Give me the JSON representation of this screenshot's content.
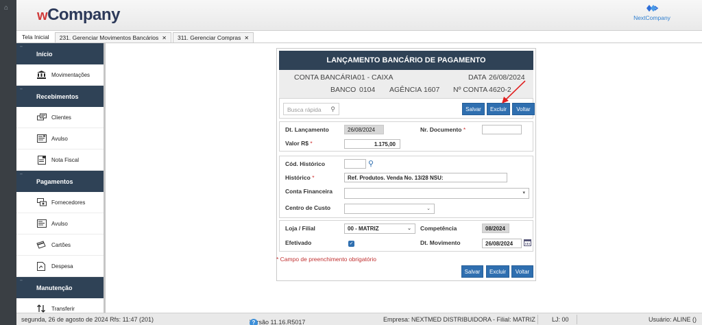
{
  "header": {
    "logo_w": "w",
    "logo_rest": "Company",
    "partner_logo": "NextCompany"
  },
  "tabs": [
    {
      "label": "Tela Inicial"
    },
    {
      "label": "231. Gerenciar Movimentos Bancários",
      "close": "✕"
    },
    {
      "label": "311. Gerenciar Compras",
      "close": "✕"
    }
  ],
  "sidebar": {
    "sections": [
      {
        "label": "Início"
      },
      {
        "label": "Recebimentos"
      },
      {
        "label": "Pagamentos"
      },
      {
        "label": "Manutenção"
      }
    ],
    "items": [
      {
        "label": "Movimentações",
        "icon": "bank-icon"
      },
      {
        "label": "Clientes",
        "icon": "clients-icon"
      },
      {
        "label": "Avulso",
        "icon": "receipt-icon"
      },
      {
        "label": "Nota Fiscal",
        "icon": "invoice-icon"
      },
      {
        "label": "Fornecedores",
        "icon": "suppliers-icon"
      },
      {
        "label": "Avulso",
        "icon": "receipt-icon"
      },
      {
        "label": "Cartões",
        "icon": "cards-icon"
      },
      {
        "label": "Despesa",
        "icon": "expense-icon"
      },
      {
        "label": "Transferir",
        "icon": "transfer-icon"
      }
    ]
  },
  "form": {
    "title": "LANÇAMENTO BANCÁRIO DE PAGAMENTO",
    "account": {
      "conta_label": "CONTA BANCÁRIA",
      "conta_value": "01 - CAIXA",
      "data_label": "DATA",
      "data_value": "26/08/2024",
      "banco_label": "BANCO",
      "banco_value": "0104",
      "agencia_label": "AGÊNCIA",
      "agencia_value": "1607",
      "nconta_label": "Nº CONTA",
      "nconta_value": "4620-2"
    },
    "search_placeholder": "Busca rápida",
    "buttons": {
      "save": "Salvar",
      "delete": "Excluir",
      "back": "Voltar"
    },
    "fields": {
      "dt_lancamento_label": "Dt. Lançamento",
      "dt_lancamento_value": "26/08/2024",
      "nr_documento_label": "Nr. Documento",
      "nr_documento_value": "",
      "valor_label": "Valor R$",
      "valor_value": "1.175,00",
      "cod_historico_label": "Cód. Histórico",
      "cod_historico_value": "",
      "historico_label": "Histórico",
      "historico_value": "Ref.  Produtos. Venda  No. 13/28 NSU:",
      "conta_financeira_label": "Conta Financeira",
      "conta_financeira_value": "",
      "centro_custo_label": "Centro de Custo",
      "centro_custo_value": "",
      "loja_label": "Loja / Filial",
      "loja_value": "00 - MATRIZ",
      "competencia_label": "Competência",
      "competencia_value": "08/2024",
      "efetivado_label": "Efetivado",
      "efetivado_checked": true,
      "dt_movimento_label": "Dt. Movimento",
      "dt_movimento_value": "26/08/2024"
    },
    "required_symbol": "*",
    "mandatory_note": "* Campo de preenchimento obrigatório"
  },
  "status": {
    "date": "segunda, 26 de agosto de 2024  Rfs: 11:47 (201)",
    "version": "Versão 11.16.R5017",
    "company": "Empresa: NEXTMED DISTRIBUIDORA - Filial: MATRIZ",
    "lj": "LJ: 00",
    "user": "Usuário: ALINE ()"
  },
  "colors": {
    "navy": "#2f4256",
    "button_blue": "#2f6fb0",
    "required_red": "#d03030",
    "annotation_arrow": "#e02020"
  }
}
